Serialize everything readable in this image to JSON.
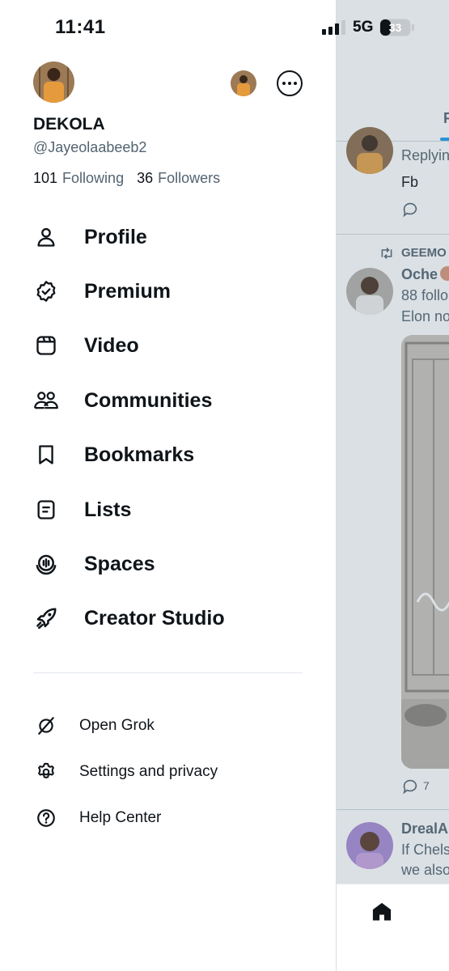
{
  "status_bar": {
    "time": "11:41",
    "network": "5G",
    "battery": "33"
  },
  "profile": {
    "name": "DEKOLA",
    "handle": "@Jayeolaabeeb2",
    "following_count": "101",
    "following_label": "Following",
    "followers_count": "36",
    "followers_label": "Followers"
  },
  "menu": [
    {
      "label": "Profile",
      "icon": "person-icon"
    },
    {
      "label": "Premium",
      "icon": "verified-badge-icon"
    },
    {
      "label": "Video",
      "icon": "video-icon"
    },
    {
      "label": "Communities",
      "icon": "communities-icon"
    },
    {
      "label": "Bookmarks",
      "icon": "bookmark-icon"
    },
    {
      "label": "Lists",
      "icon": "list-icon"
    },
    {
      "label": "Spaces",
      "icon": "spaces-icon"
    },
    {
      "label": "Creator Studio",
      "icon": "rocket-icon"
    }
  ],
  "secondary_menu": [
    {
      "label": "Open Grok",
      "icon": "grok-icon"
    },
    {
      "label": "Settings and privacy",
      "icon": "gear-icon"
    },
    {
      "label": "Help Center",
      "icon": "help-icon"
    }
  ],
  "feed": {
    "tab_partial": "F",
    "post1": {
      "text_partial_1": "Replyin",
      "text_partial_2": "Fb"
    },
    "post2": {
      "retweet_partial": "GEEMO",
      "name_partial": "Oche",
      "text_partial_1": "88 follo",
      "text_partial_2": "Elon no",
      "reply_count": "7"
    },
    "post3": {
      "name_partial": "DrealA",
      "text_partial_1": "If Chels",
      "text_partial_2": "we also"
    }
  },
  "colors": {
    "accent": "#1d9bf0",
    "text_primary": "#0f1419",
    "text_secondary": "#536471"
  }
}
